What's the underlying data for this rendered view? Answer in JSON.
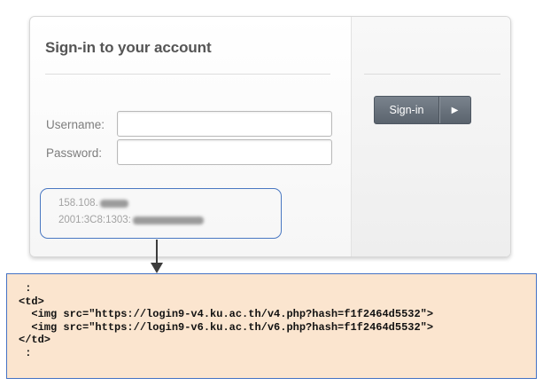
{
  "login": {
    "title": "Sign-in to your account",
    "username_label": "Username:",
    "username_value": "",
    "password_label": "Password:",
    "password_value": "",
    "signin_label": "Sign-in",
    "signin_arrow": "▶"
  },
  "ip_info": {
    "ipv4_prefix": "158.108.",
    "ipv6_prefix": "2001:3C8:1303:"
  },
  "code_snippet": {
    "lines": [
      " :",
      "<td>",
      "  <img src=\"https://login9-v4.ku.ac.th/v4.php?hash=f1f2464d5532\">",
      "  <img src=\"https://login9-v6.ku.ac.th/v6.php?hash=f1f2464d5532\">",
      "</td>",
      " :"
    ]
  },
  "colors": {
    "callout_border": "#4472c4",
    "code_background": "#fbe5cf",
    "button": "#5f6771"
  }
}
